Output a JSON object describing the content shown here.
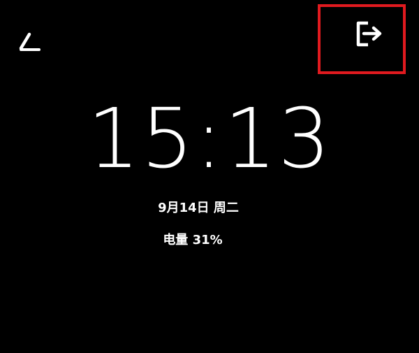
{
  "lock_screen": {
    "time": "15:13",
    "date": "9月14日 周二",
    "battery": "电量 31%"
  },
  "toolbar": {
    "edit_icon": "edit-pencil-icon",
    "exit_icon": "exit-logout-icon",
    "highlight_color": "#e11a1f"
  },
  "colors": {
    "background": "#000000",
    "text": "#ffffff"
  }
}
